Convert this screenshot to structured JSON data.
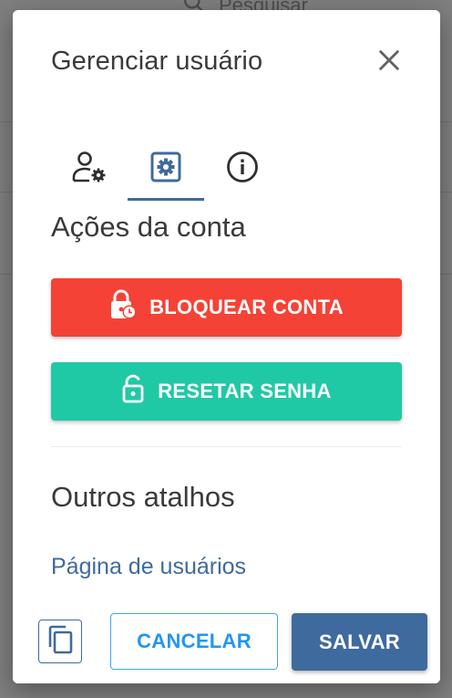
{
  "background": {
    "search_placeholder": "Pesquisar"
  },
  "dialog": {
    "title": "Gerenciar usuário",
    "close_icon": "close-icon",
    "tabs": [
      {
        "icon": "user-settings-icon",
        "selected": false
      },
      {
        "icon": "settings-box-icon",
        "selected": true
      },
      {
        "icon": "info-icon",
        "selected": false
      }
    ],
    "account_actions": {
      "title": "Ações da conta",
      "lock_button": {
        "label": "BLOQUEAR CONTA",
        "icon": "lock-clock-icon",
        "color": "#f44336"
      },
      "reset_button": {
        "label": "RESETAR SENHA",
        "icon": "lock-open-icon",
        "color": "#20c9a5"
      }
    },
    "shortcuts": {
      "title": "Outros atalhos",
      "users_page_link": "Página de usuários"
    },
    "footer": {
      "copy_icon": "copy-icon",
      "cancel_label": "CANCELAR",
      "save_label": "SALVAR"
    }
  },
  "colors": {
    "primary": "#3f6a9e",
    "danger": "#f44336",
    "success": "#20c9a5",
    "cancel_accent": "#2196f3"
  }
}
